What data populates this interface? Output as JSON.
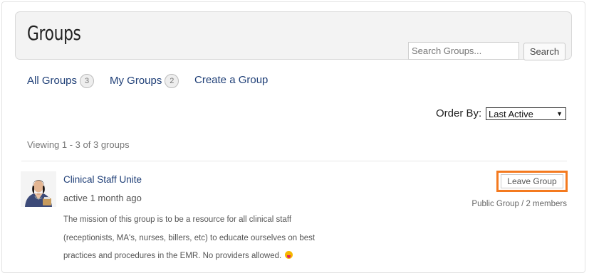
{
  "header": {
    "title": "Groups",
    "search_placeholder": "Search Groups...",
    "search_button": "Search"
  },
  "tabs": [
    {
      "label": "All Groups",
      "count": "3"
    },
    {
      "label": "My Groups",
      "count": "2"
    },
    {
      "label": "Create a Group"
    }
  ],
  "order": {
    "label": "Order By:",
    "selected": "Last Active"
  },
  "viewing": "Viewing 1 - 3 of 3 groups",
  "groups": [
    {
      "name": "Clinical Staff Unite",
      "active": "active 1 month ago",
      "description": "The mission of this group is to be a resource for all clinical staff (receptionists, MA's, nurses, billers, etc) to educate ourselves on best practices and procedures in the EMR. No providers allowed.",
      "emoji_icon": "tongue-out-emoji-icon",
      "leave_label": "Leave Group",
      "meta": "Public Group / 2 members"
    }
  ],
  "colors": {
    "link": "#1f3f77",
    "highlight": "#f47a1f"
  }
}
